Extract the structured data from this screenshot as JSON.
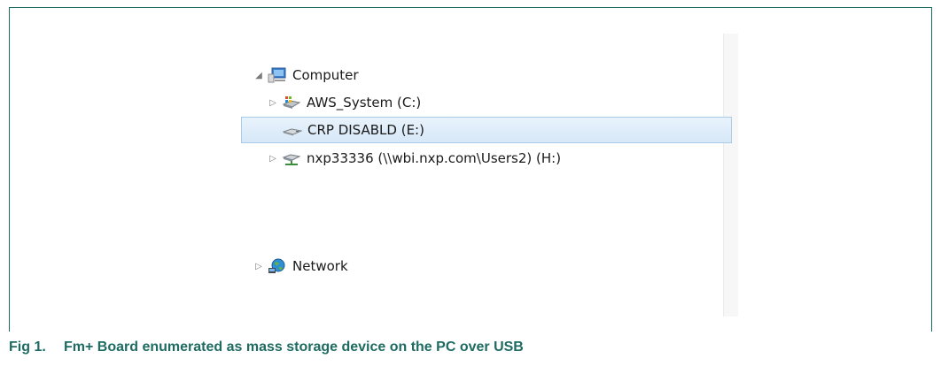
{
  "tree": {
    "computer": {
      "label": "Computer",
      "expander": "expanded",
      "icon": "computer-icon"
    },
    "items": [
      {
        "label": "AWS_System (C:)",
        "expander": "collapsed",
        "icon": "system-drive-icon"
      },
      {
        "label": "CRP DISABLD (E:)",
        "expander": "none",
        "icon": "removable-drive-icon",
        "selected": true
      },
      {
        "label": "nxp33336 (\\\\wbi.nxp.com\\Users2) (H:)",
        "expander": "collapsed",
        "icon": "network-drive-icon"
      }
    ],
    "network": {
      "label": "Network",
      "expander": "collapsed",
      "icon": "network-globe-icon"
    }
  },
  "caption": {
    "number": "Fig 1.",
    "text": "Fm+ Board enumerated as mass storage device on the PC over USB"
  },
  "colors": {
    "frame": "#1e6b62",
    "caption": "#1e6b62",
    "selection_fill": "#d7e8f8",
    "selection_border": "#a8cbe9"
  }
}
